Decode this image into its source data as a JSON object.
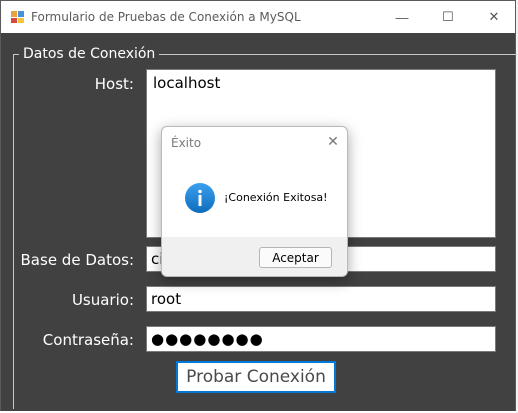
{
  "window": {
    "title": "Formulario de Pruebas de Conexión a MySQL",
    "controls": {
      "minimize": "—",
      "maximize": "☐",
      "close": "✕"
    }
  },
  "group": {
    "legend": "Datos de Conexión"
  },
  "form": {
    "host": {
      "label": "Host:",
      "value": "localhost"
    },
    "database": {
      "label": "Base de Datos:",
      "value": "ci"
    },
    "user": {
      "label": "Usuario:",
      "value": "root"
    },
    "password": {
      "label": "Contraseña:",
      "value": "●●●●●●●●"
    },
    "test_button": "Probar Conexión"
  },
  "dialog": {
    "title": "Éxito",
    "close": "✕",
    "icon": "info-icon",
    "message": "¡Conexión Exitosa!",
    "ok_button": "Aceptar"
  },
  "colors": {
    "client_bg": "#414141",
    "accent": "#0078d7",
    "info_icon": "#1a7fd4"
  }
}
